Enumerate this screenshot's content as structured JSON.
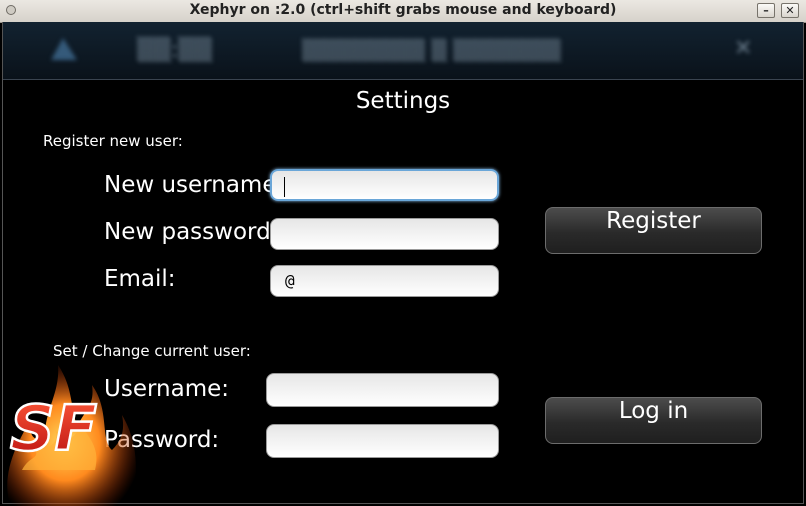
{
  "window": {
    "title": "Xephyr on :2.0 (ctrl+shift grabs mouse and keyboard)",
    "minimize_glyph": "–",
    "close_glyph": "✕"
  },
  "dialog": {
    "title": "Settings",
    "register": {
      "section_label": "Register new user:",
      "username_label": "New username:",
      "username_value": "",
      "password_label": "New password:",
      "password_value": "",
      "email_label": "Email:",
      "email_value": "@",
      "button_label": "Register"
    },
    "login": {
      "section_label": "Set / Change current user:",
      "username_label": "Username:",
      "username_value": "",
      "password_label": "Password:",
      "password_value": "",
      "button_label": "Log in"
    }
  },
  "logo": {
    "text": "SF"
  },
  "colors": {
    "background": "#000000",
    "focus_border": "#6aa6d8",
    "button_top": "#4c4c4c",
    "button_bottom": "#1f1f1f"
  }
}
